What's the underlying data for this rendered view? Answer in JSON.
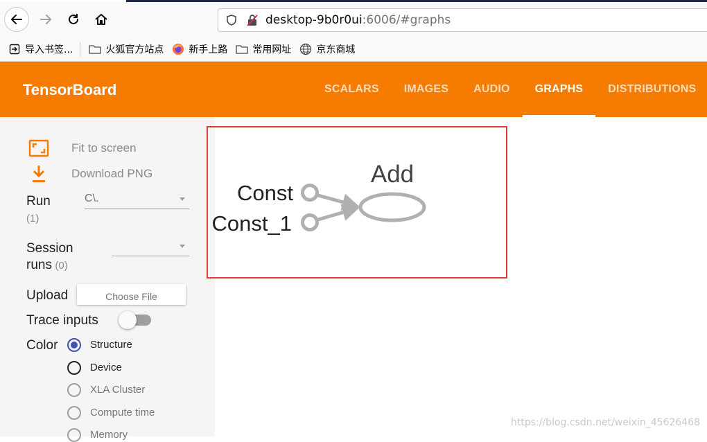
{
  "browser": {
    "url_host": "desktop-9b0r0ui",
    "url_rest": ":6006/#graphs",
    "bookmarks": [
      {
        "label": "导入书签..."
      },
      {
        "label": "火狐官方站点"
      },
      {
        "label": "新手上路"
      },
      {
        "label": "常用网址"
      },
      {
        "label": "京东商城"
      }
    ]
  },
  "header": {
    "title": "TensorBoard",
    "tabs": [
      {
        "label": "SCALARS"
      },
      {
        "label": "IMAGES"
      },
      {
        "label": "AUDIO"
      },
      {
        "label": "GRAPHS"
      },
      {
        "label": "DISTRIBUTIONS"
      }
    ],
    "active_tab": "GRAPHS",
    "color": "#f57c00"
  },
  "sidebar": {
    "fit_label": "Fit to screen",
    "download_label": "Download PNG",
    "run_label": "Run",
    "run_count": "(1)",
    "run_value": "C\\.",
    "session_label_1": "Session",
    "session_label_2": "runs",
    "session_count": "(0)",
    "session_value": "",
    "upload_label": "Upload",
    "choose_file": "Choose File",
    "trace_label": "Trace inputs",
    "color_label": "Color",
    "color_options": [
      {
        "label": "Structure"
      },
      {
        "label": "Device"
      },
      {
        "label": "XLA Cluster"
      },
      {
        "label": "Compute time"
      },
      {
        "label": "Memory"
      }
    ]
  },
  "graph": {
    "node_const": "Const",
    "node_const1": "Const_1",
    "node_add": "Add"
  },
  "watermark": "https://blog.csdn.net/weixin_45626468"
}
